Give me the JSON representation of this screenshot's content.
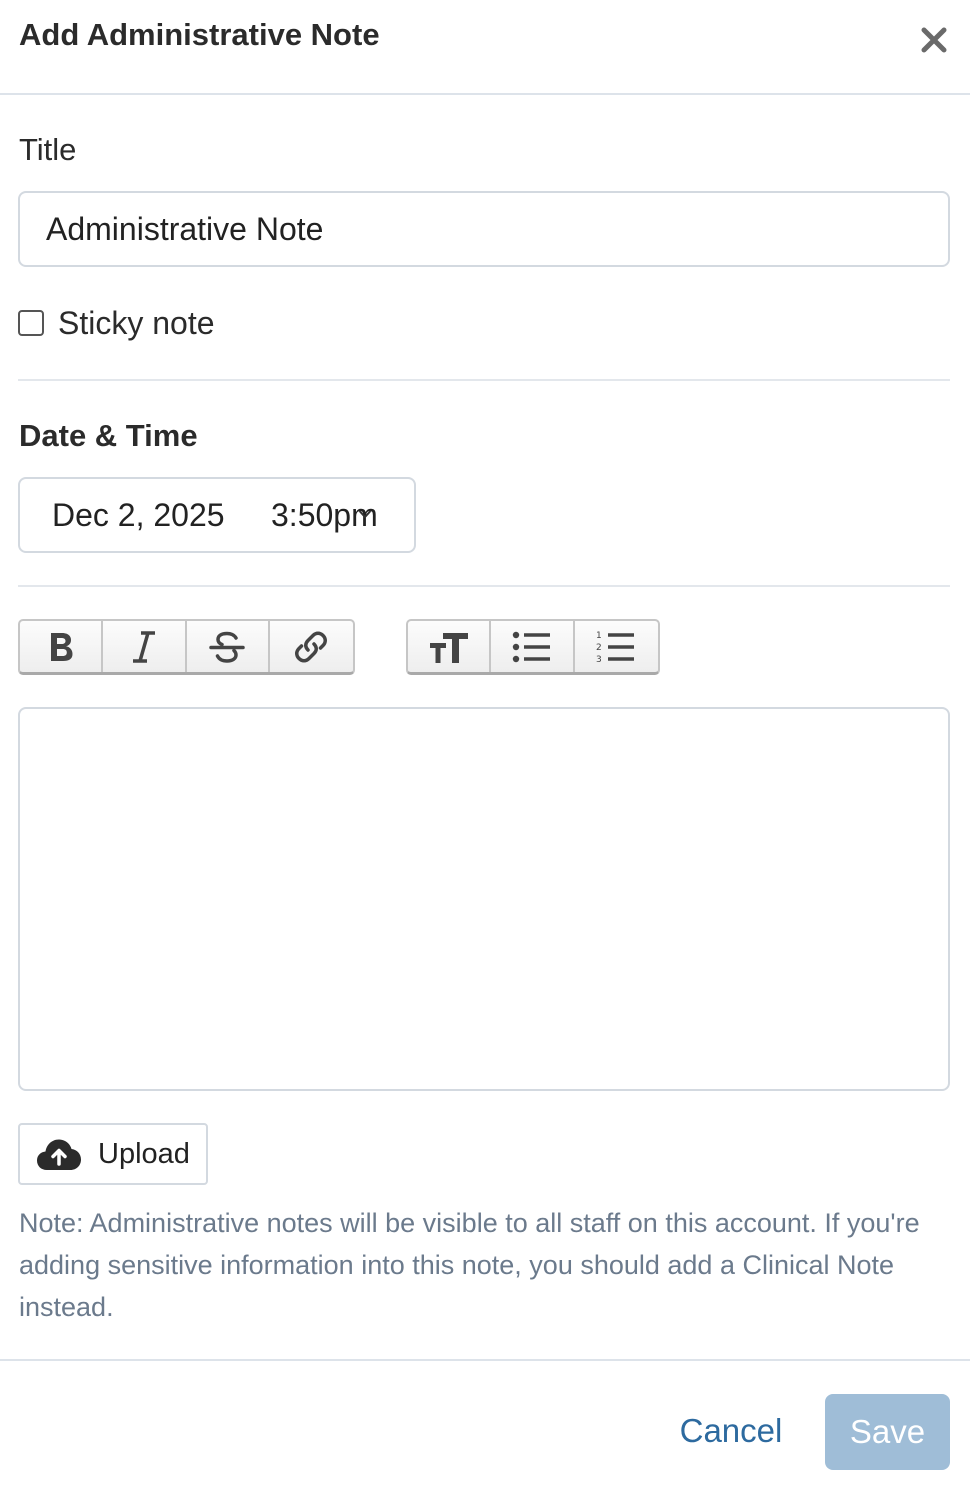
{
  "dialog": {
    "title": "Add Administrative Note",
    "close_icon": "close-icon"
  },
  "title_field": {
    "label": "Title",
    "value": "Administrative Note"
  },
  "sticky_note": {
    "label": "Sticky note",
    "checked": false
  },
  "date_time": {
    "heading": "Date & Time",
    "date": "Dec 2, 2025",
    "time": "3:50pm"
  },
  "editor": {
    "toolbar_format": [
      "bold-icon",
      "italic-icon",
      "strikethrough-icon",
      "link-icon"
    ],
    "toolbar_structure": [
      "text-size-icon",
      "bullet-list-icon",
      "numbered-list-icon"
    ],
    "content": ""
  },
  "upload": {
    "label": "Upload",
    "icon": "cloud-upload-icon"
  },
  "note": "Note: Administrative notes will be visible to all staff on this account. If you're adding sensitive information into this note, you should add a Clinical Note instead.",
  "footer": {
    "cancel_label": "Cancel",
    "save_label": "Save"
  },
  "colors": {
    "link_blue": "#2d6a9f",
    "save_disabled": "#9fbdd7",
    "note_gray": "#6b7a8c",
    "border": "#d3d9e0"
  }
}
